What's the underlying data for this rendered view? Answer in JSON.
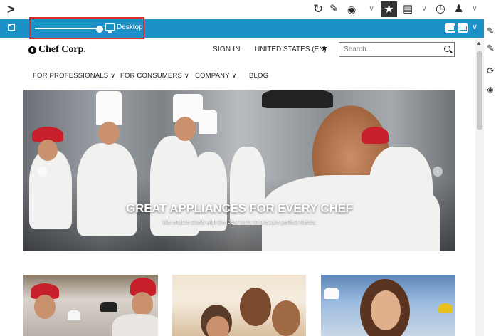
{
  "toolbar": {
    "expand_glyph": ">",
    "icons": [
      "reload-icon",
      "open-external-icon",
      "share-icon",
      "star-icon",
      "chart-icon",
      "clock-icon",
      "user-icon"
    ]
  },
  "preview_bar": {
    "device_label": "Desktop",
    "slider_value": 0.95,
    "accent_color": "#1c91c8",
    "selection_color": "#e12a2a"
  },
  "site": {
    "logo_text": "Chef Corp.",
    "signin_label": "SIGN IN",
    "locale_label": "UNITED STATES (EN)",
    "search_placeholder": "Search...",
    "nav": [
      {
        "label": "FOR PROFESSIONALS ∨"
      },
      {
        "label": "FOR CONSUMERS ∨"
      },
      {
        "label": "COMPANY ∨"
      },
      {
        "label": "BLOG"
      }
    ],
    "hero": {
      "title": "GREAT APPLIANCES FOR EVERY CHEF",
      "subtitle": "We enable chefs with the best tools to prepare perfect meals.",
      "prev_glyph": "‹",
      "next_glyph": "›"
    }
  }
}
